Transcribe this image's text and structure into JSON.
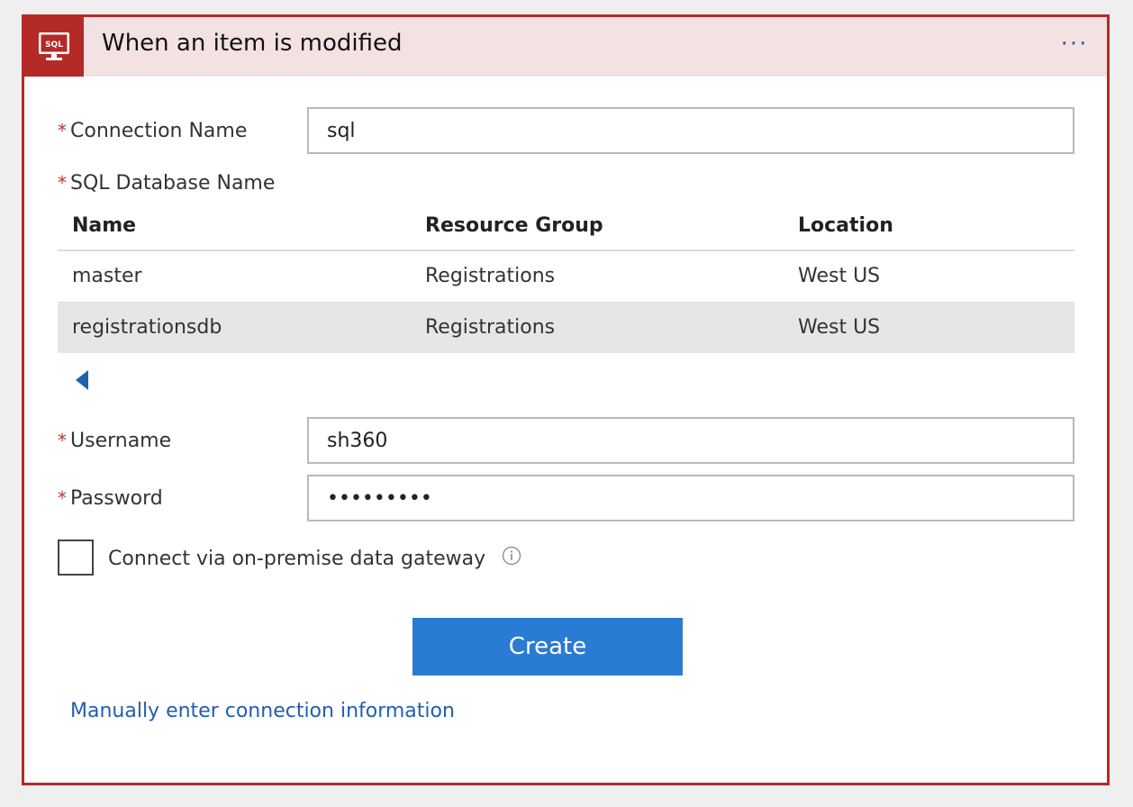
{
  "header": {
    "title": "When an item is modified",
    "icon_text": "SQL",
    "more_label": "···",
    "accent_color": "#b42a27",
    "header_bg": "#f4e2e3"
  },
  "form": {
    "required_mark": "*",
    "connection_name": {
      "label": "Connection Name",
      "value": "sql"
    },
    "database_name": {
      "label": "SQL Database Name"
    },
    "username": {
      "label": "Username",
      "value": "sh360"
    },
    "password": {
      "label": "Password",
      "value": "•••••••••"
    }
  },
  "table": {
    "columns": [
      "Name",
      "Resource Group",
      "Location"
    ],
    "rows": [
      {
        "name": "master",
        "resource_group": "Registrations",
        "location": "West US",
        "selected": false
      },
      {
        "name": "registrationsdb",
        "resource_group": "Registrations",
        "location": "West US",
        "selected": true
      }
    ]
  },
  "gateway": {
    "label": "Connect via on-premise data gateway",
    "checked": false
  },
  "actions": {
    "create_label": "Create",
    "create_color": "#2a7bd3",
    "manual_link": "Manually enter connection information",
    "link_color": "#1f5fae"
  }
}
